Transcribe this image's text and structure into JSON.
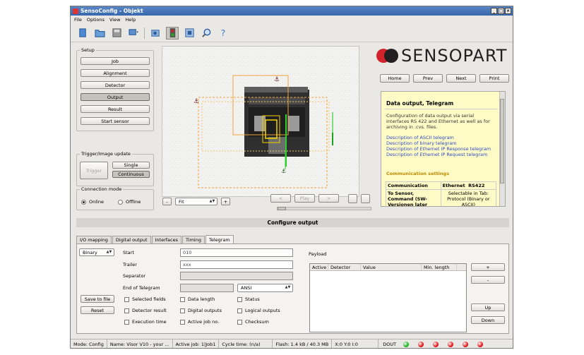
{
  "window": {
    "title": "SensoConfig - Objekt"
  },
  "menu": [
    "File",
    "Options",
    "View",
    "Help"
  ],
  "toolbar_icons": [
    "connect-icon",
    "open-icon",
    "save-icon",
    "monitor-icon",
    "camera-icon",
    "sensor-icon",
    "image-icon",
    "search-icon",
    "help-icon"
  ],
  "setup": {
    "label": "Setup",
    "buttons": [
      "Job",
      "Alignment",
      "Detector",
      "Output",
      "Result",
      "Start sensor"
    ],
    "active": "Output"
  },
  "trigger": {
    "label": "Trigger/Image update",
    "trigger_btn": "Trigger",
    "single_btn": "Single",
    "continuous_btn": "Continuous"
  },
  "connection": {
    "label": "Connection mode",
    "online": "Online",
    "offline": "Offline"
  },
  "image_controls": {
    "zoom_minus": "-",
    "zoom_value": "Fit",
    "zoom_plus": "+",
    "prev": "<",
    "play": "Play",
    "next": ">"
  },
  "logo": {
    "text": "SENSOPART"
  },
  "help_nav": {
    "home": "Home",
    "prev": "Prev",
    "next": "Next",
    "print": "Print"
  },
  "help": {
    "title": "Data output, Telegram",
    "body": "Configuration of data output via serial interfaces RS 422 and Ethernet as well as for archiving in .cvs. files.",
    "links": [
      "Description of ASCII telegram",
      "Description of binary telegram",
      "Description of Ethernet IP Response telegram",
      "Description of Ethernet IP Request telegram"
    ],
    "subtitle": "Communication settings",
    "table": {
      "headers": [
        "Communication",
        "Ethernet",
        "RS422"
      ],
      "row": [
        "To Sensor, Command (SW-Versionen later",
        "Selectable in Tab: Protocol (Binary or ASCII)"
      ]
    }
  },
  "configure": {
    "title": "Configure output"
  },
  "tabs": [
    "I/O mapping",
    "Digital output",
    "Interfaces",
    "Timing",
    "Telegram"
  ],
  "active_tab": "Telegram",
  "telegram": {
    "format": "Binary",
    "start_label": "Start",
    "start_value": "010",
    "trailer_label": "Trailer",
    "trailer_value": "xxx",
    "separator_label": "Separator",
    "end_label": "End of Telegram",
    "end_select": "ANSI",
    "save_btn": "Save to file",
    "reset_btn": "Reset",
    "checkboxes": [
      "Selected fields",
      "Data length",
      "Status",
      "Detector result",
      "Digital outputs",
      "Logical outputs",
      "Execution time",
      "Active job no.",
      "Checksum"
    ]
  },
  "payload": {
    "label": "Payload",
    "columns": [
      "Active",
      "Detector",
      "Value",
      "Min. length"
    ],
    "buttons": {
      "add": "+",
      "remove": "-",
      "up": "Up",
      "down": "Down"
    }
  },
  "status": {
    "mode": "Mode:  Config",
    "name": "Name:  Visor V10 - your ...",
    "job": "Active job:  1|Job1",
    "cycle": "Cycle time:  (n/a)",
    "flash": "Flash:  1.4 kB / 40.3 MB",
    "coords": "X:0 Y:0 I:0",
    "dout": "DOUT",
    "led_colors": [
      "#19b51d",
      "#e0171b",
      "#e0171b",
      "#e0171b",
      "#e0171b",
      "#e0171b"
    ]
  }
}
